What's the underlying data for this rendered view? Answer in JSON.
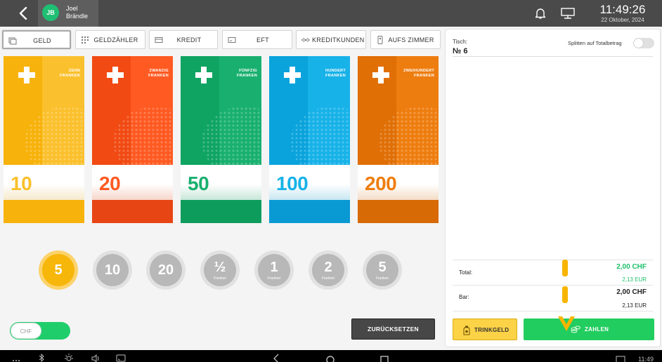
{
  "header": {
    "back_icon": "chevron-left-icon",
    "user": {
      "initials": "JB",
      "first_name": "Joel",
      "last_name": "Brändle"
    },
    "icons": [
      "bell-icon",
      "monitor-icon"
    ],
    "time": "11:49:26",
    "date": "22 Oktober, 2024"
  },
  "payment_tabs": [
    {
      "label": "GELD",
      "icon": "cash-icon",
      "active": true
    },
    {
      "label": "GELDZÄHLER",
      "icon": "counter-icon",
      "active": false
    },
    {
      "label": "KREDIT",
      "icon": "card-icon",
      "active": false
    },
    {
      "label": "EFT",
      "icon": "terminal-icon",
      "active": false
    },
    {
      "label": "KREDITKUNDEN",
      "icon": "handshake-icon",
      "active": false
    },
    {
      "label": "AUFS ZIMMER",
      "icon": "room-key-icon",
      "active": false
    }
  ],
  "banknotes": [
    {
      "value": "10",
      "label_line1": "ZEHN",
      "label_line2": "FRANKEN",
      "color": "#fbc02d",
      "dark": "#f7b20b",
      "strip_color": "#f7b20b"
    },
    {
      "value": "20",
      "label_line1": "ZWANZIG",
      "label_line2": "FRANKEN",
      "color": "#ff5a22",
      "dark": "#f14a12",
      "strip_color": "#e84514"
    },
    {
      "value": "50",
      "label_line1": "FÜNFZIG",
      "label_line2": "FRANKEN",
      "color": "#19b06f",
      "dark": "#0fa462",
      "strip_color": "#0e9c5d"
    },
    {
      "value": "100",
      "label_line1": "HUNDERT",
      "label_line2": "FRANKEN",
      "color": "#17b2e8",
      "dark": "#0aa3dc",
      "strip_color": "#0a9ad3"
    },
    {
      "value": "200",
      "label_line1": "ZWEIHUNDERT",
      "label_line2": "FRANKEN",
      "color": "#ee7d0f",
      "dark": "#e06f06",
      "strip_color": "#d76a05"
    }
  ],
  "coins": [
    {
      "value": "5",
      "sub": "",
      "selected": true
    },
    {
      "value": "10",
      "sub": "",
      "selected": false
    },
    {
      "value": "20",
      "sub": "",
      "selected": false
    },
    {
      "value": "½",
      "sub": "Franken",
      "selected": false
    },
    {
      "value": "1",
      "sub": "Franken",
      "selected": false
    },
    {
      "value": "2",
      "sub": "Franken",
      "selected": false
    },
    {
      "value": "5",
      "sub": "Franken",
      "selected": false
    }
  ],
  "currency_toggle": {
    "label": "CHF"
  },
  "reset_label": "ZURÜCKSETZEN",
  "order_panel": {
    "table_label": "Tisch:",
    "table_number": "№ 6",
    "split_label": "Splitten auf Totalbetrag",
    "split_on": false,
    "total_label": "Total:",
    "total_chf": "2,00 CHF",
    "total_eur": "2,13 EUR",
    "cash_label": "Bar:",
    "cash_chf": "2,00 CHF",
    "cash_eur": "2,13 EUR",
    "tip_label": "TRINKGELD",
    "pay_label": "ZAHLEN"
  },
  "navbar": {
    "icons": [
      "apps-icon",
      "bluetooth-icon",
      "brightness-icon",
      "volume-icon",
      "cast-icon",
      "nav-back-icon",
      "nav-home-icon",
      "nav-recents-icon",
      "screenshot-icon"
    ],
    "time": "11:49"
  },
  "colors": {
    "accent_green": "#1fc06c",
    "accent_yellow": "#f7b500",
    "header_bg": "#4a4a4a"
  }
}
